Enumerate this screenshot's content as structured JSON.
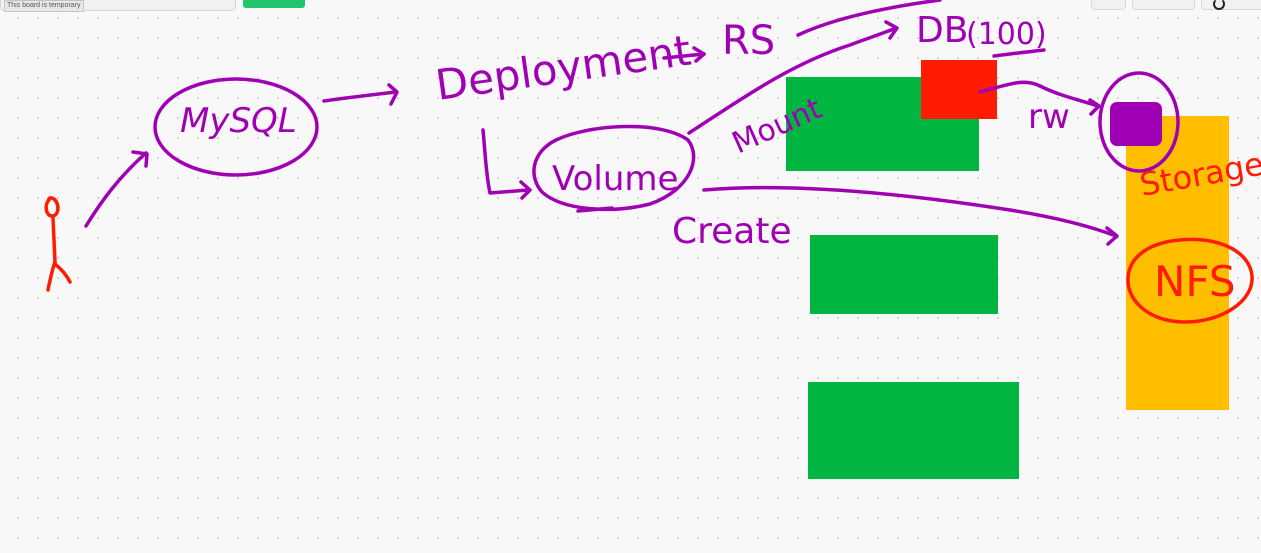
{
  "header": {
    "temporary_notice": "This board is temporary"
  },
  "canvas": {
    "notes": {
      "green": "#00b640",
      "red": "#ff1c00",
      "yellow": "#ffbf00"
    },
    "ink": {
      "purple": "#a000b4",
      "red": "#ff1c00"
    },
    "labels": {
      "mysql": "MySQL",
      "deployment": "Deployment",
      "rs": "RS",
      "db": "DB",
      "db_port": "(100)",
      "volume": "Volume",
      "mount": "Mount",
      "create": "Create",
      "rw": "rw",
      "storage": "Storage",
      "nfs": "NFS"
    }
  }
}
